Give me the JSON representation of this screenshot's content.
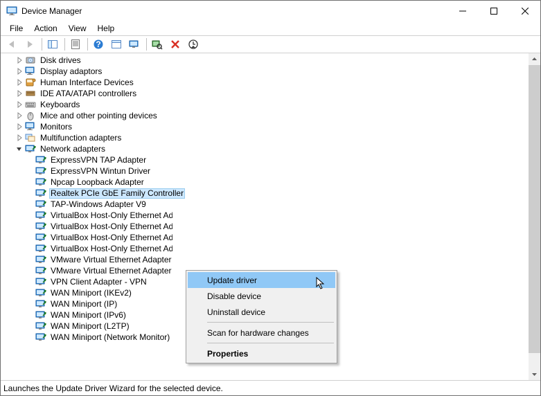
{
  "title": "Device Manager",
  "menu": [
    "File",
    "Action",
    "View",
    "Help"
  ],
  "toolbar_icons": [
    "back",
    "forward",
    "sep",
    "show-hide",
    "sep",
    "properties",
    "sep",
    "help",
    "set",
    "monitor",
    "sep",
    "scan",
    "uninstall",
    "update"
  ],
  "categories": [
    {
      "label": "Disk drives",
      "icon": "disk",
      "expanded": false
    },
    {
      "label": "Display adaptors",
      "icon": "display",
      "expanded": false
    },
    {
      "label": "Human Interface Devices",
      "icon": "hid",
      "expanded": false
    },
    {
      "label": "IDE ATA/ATAPI controllers",
      "icon": "ide",
      "expanded": false
    },
    {
      "label": "Keyboards",
      "icon": "keyboard",
      "expanded": false
    },
    {
      "label": "Mice and other pointing devices",
      "icon": "mouse",
      "expanded": false
    },
    {
      "label": "Monitors",
      "icon": "monitor",
      "expanded": false
    },
    {
      "label": "Multifunction adapters",
      "icon": "multi",
      "expanded": false
    },
    {
      "label": "Network adapters",
      "icon": "net",
      "expanded": true,
      "children": [
        {
          "label": "ExpressVPN TAP Adapter",
          "icon": "net"
        },
        {
          "label": "ExpressVPN Wintun Driver",
          "icon": "net"
        },
        {
          "label": "Npcap Loopback Adapter",
          "icon": "net"
        },
        {
          "label": "Realtek PCIe GbE Family Controller",
          "icon": "net",
          "selected": true
        },
        {
          "label": "TAP-Windows Adapter V9",
          "icon": "net"
        },
        {
          "label": "VirtualBox Host-Only Ethernet Adapter",
          "icon": "net",
          "truncated": true
        },
        {
          "label": "VirtualBox Host-Only Ethernet Adapter",
          "icon": "net",
          "truncated": true
        },
        {
          "label": "VirtualBox Host-Only Ethernet Adapter",
          "icon": "net",
          "truncated": true
        },
        {
          "label": "VirtualBox Host-Only Ethernet Adapter",
          "icon": "net",
          "truncated": true
        },
        {
          "label": "VMware Virtual Ethernet Adapter",
          "icon": "net",
          "truncated": true
        },
        {
          "label": "VMware Virtual Ethernet Adapter",
          "icon": "net",
          "truncated": true
        },
        {
          "label": "VPN Client Adapter - VPN",
          "icon": "net"
        },
        {
          "label": "WAN Miniport (IKEv2)",
          "icon": "net"
        },
        {
          "label": "WAN Miniport (IP)",
          "icon": "net"
        },
        {
          "label": "WAN Miniport (IPv6)",
          "icon": "net"
        },
        {
          "label": "WAN Miniport (L2TP)",
          "icon": "net"
        },
        {
          "label": "WAN Miniport (Network Monitor)",
          "icon": "net"
        }
      ]
    }
  ],
  "context_menu": [
    {
      "label": "Update driver",
      "highlight": true
    },
    {
      "label": "Disable device"
    },
    {
      "label": "Uninstall device"
    },
    {
      "sep": true
    },
    {
      "label": "Scan for hardware changes"
    },
    {
      "sep": true
    },
    {
      "label": "Properties",
      "bold": true
    }
  ],
  "statusbar": "Launches the Update Driver Wizard for the selected device."
}
